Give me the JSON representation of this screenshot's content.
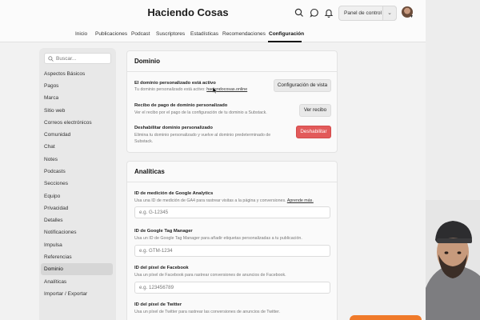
{
  "header": {
    "site_title": "Haciendo Cosas",
    "panel_label": "Panel de control",
    "icons": [
      "search-icon",
      "chat-icon",
      "bell-icon",
      "chevron-down-icon"
    ]
  },
  "tabs": [
    {
      "label": "Inicio"
    },
    {
      "label": "Publicaciones"
    },
    {
      "label": "Podcast"
    },
    {
      "label": "Suscriptores"
    },
    {
      "label": "Estadísticas"
    },
    {
      "label": "Recomendaciones"
    },
    {
      "label": "Configuración",
      "active": true
    }
  ],
  "sidebar": {
    "search_placeholder": "Buscar...",
    "active_item": "Dominio",
    "items": [
      "Aspectos Básicos",
      "Pagos",
      "Marca",
      "Sitio web",
      "Correos electrónicos",
      "Comunidad",
      "Chat",
      "Notes",
      "Podcasts",
      "Secciones",
      "Equipo",
      "Privacidad",
      "Detalles",
      "Notificaciones",
      "Impulsa",
      "Referencias",
      "Dominio",
      "Analíticas",
      "Importar / Exportar"
    ]
  },
  "domain": {
    "title": "Dominio",
    "active": {
      "label": "El dominio personalizado está activo",
      "desc_prefix": "Tu dominio personalizado está activo: ",
      "domain_link": "haciendocosas.online",
      "button": "Configuración de vista"
    },
    "receipt": {
      "label": "Recibo de pago de dominio personalizado",
      "desc": "Ver el recibo por el pago de la configuración de tu dominio a Substack.",
      "button": "Ver recibo"
    },
    "disable": {
      "label": "Deshabilitar dominio personalizado",
      "desc": "Elimina tu dominio personalizado y vuelve al dominio predeterminado de Substack.",
      "button": "Deshabilitar"
    }
  },
  "analytics": {
    "title": "Analíticas",
    "fields": [
      {
        "label": "ID de medición de Google Analytics",
        "desc": "Usa una ID de medición de GA4 para rastrear visitas a la página y conversiones.",
        "link": "Aprende más.",
        "placeholder": "e.g. G-12345"
      },
      {
        "label": "ID de Google Tag Manager",
        "desc": "Usa un ID de Google Tag Manager para añadir etiquetas personalizadas a tu publicación.",
        "link": "",
        "placeholder": "e.g. GTM-1234"
      },
      {
        "label": "ID del píxel de Facebook",
        "desc": "Usa un píxel de Facebook para rastrear conversiones de anuncios de Facebook.",
        "link": "",
        "placeholder": "e.g. 123456789"
      },
      {
        "label": "ID del píxel de Twitter",
        "desc": "Usa un píxel de Twitter para rastrear las conversiones de anuncios de Twitter.",
        "link": "",
        "placeholder": ""
      }
    ]
  },
  "colors": {
    "danger": "#e25a5a",
    "accent_orange": "#f07a2a"
  }
}
